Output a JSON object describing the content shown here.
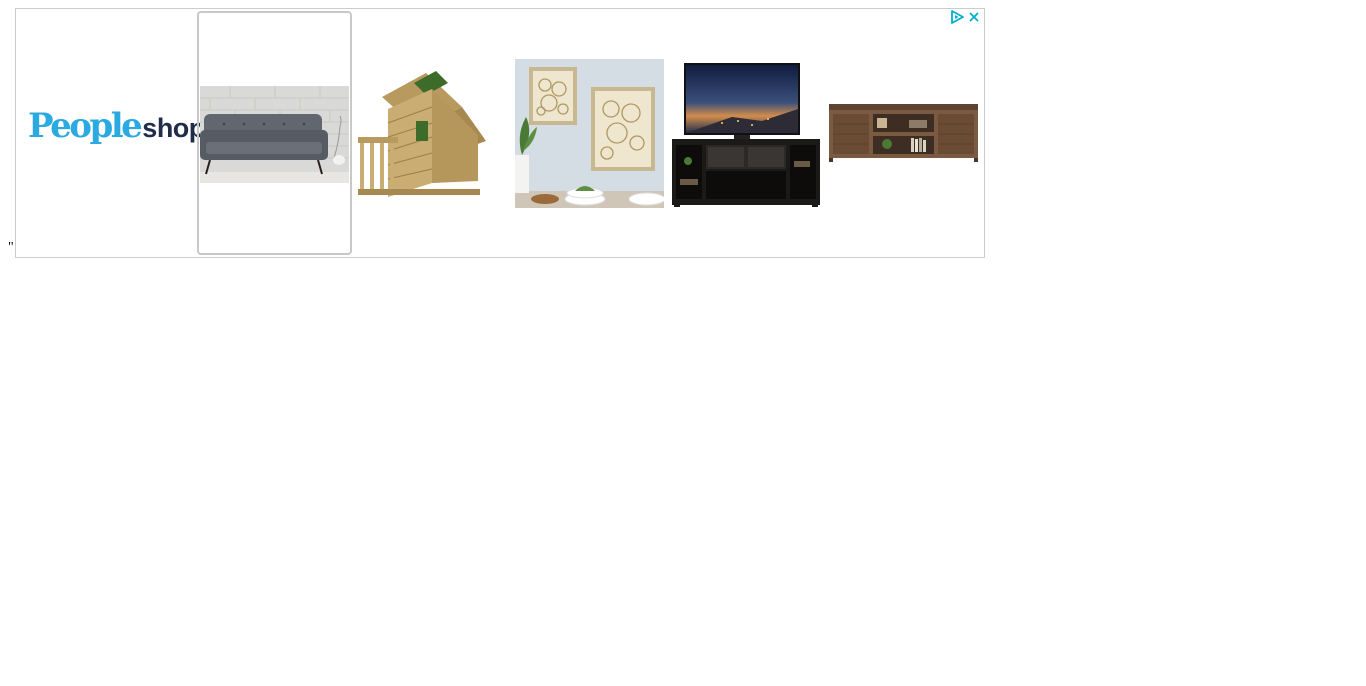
{
  "stray_text": "\"",
  "ad": {
    "brand": {
      "part1": "People",
      "part2": "shop"
    },
    "products": [
      {
        "icon": "sofa-image",
        "selected": true
      },
      {
        "icon": "wooden-playhouse-image",
        "selected": false
      },
      {
        "icon": "framed-wall-art-image",
        "selected": false
      },
      {
        "icon": "tv-stand-image",
        "selected": false
      },
      {
        "icon": "media-console-image",
        "selected": false
      }
    ],
    "colors": {
      "brand_blue": "#2ba9e1",
      "brand_navy": "#1f2d4a",
      "adchoices": "#00aecd"
    }
  }
}
